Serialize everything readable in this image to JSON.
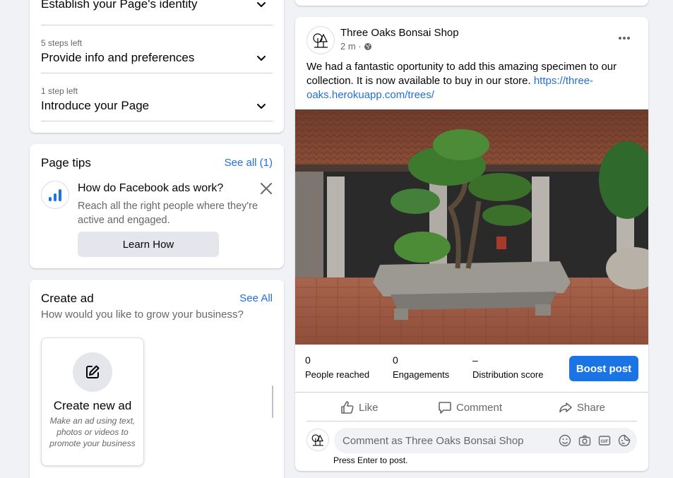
{
  "setup": {
    "steps": [
      {
        "small": "",
        "title": "Establish your Page's identity"
      },
      {
        "small": "5 steps left",
        "title": "Provide info and preferences"
      },
      {
        "small": "1 step left",
        "title": "Introduce your Page"
      }
    ]
  },
  "page_tips": {
    "title": "Page tips",
    "see_all": "See all (1)",
    "tip": {
      "heading": "How do Facebook ads work?",
      "description": "Reach all the right people where they're active and engaged.",
      "button": "Learn How"
    }
  },
  "create_ad": {
    "title": "Create ad",
    "see_all": "See All",
    "subtitle": "How would you like to grow your business?",
    "tile": {
      "title": "Create new ad",
      "description": "Make an ad using text, photos or videos to promote your business"
    }
  },
  "post": {
    "author": "Three Oaks Bonsai Shop",
    "time": "2 m ·",
    "text": "We had a fantastic oportunity to add this amazing specimen to our collection. It is now available to buy in our store. ",
    "link": "https://three-oaks.herokuapp.com/trees/",
    "metrics": [
      {
        "value": "0",
        "label": "People reached"
      },
      {
        "value": "0",
        "label": "Engagements"
      },
      {
        "value": "–",
        "label": "Distribution score"
      }
    ],
    "boost": "Boost post",
    "actions": {
      "like": "Like",
      "comment": "Comment",
      "share": "Share"
    },
    "comment_placeholder": "Comment as Three Oaks Bonsai Shop",
    "press_enter": "Press Enter to post."
  },
  "colors": {
    "accent": "#1b74e4",
    "link": "#216fdb",
    "secondary_text": "#65676b",
    "background": "#f0f2f5"
  }
}
